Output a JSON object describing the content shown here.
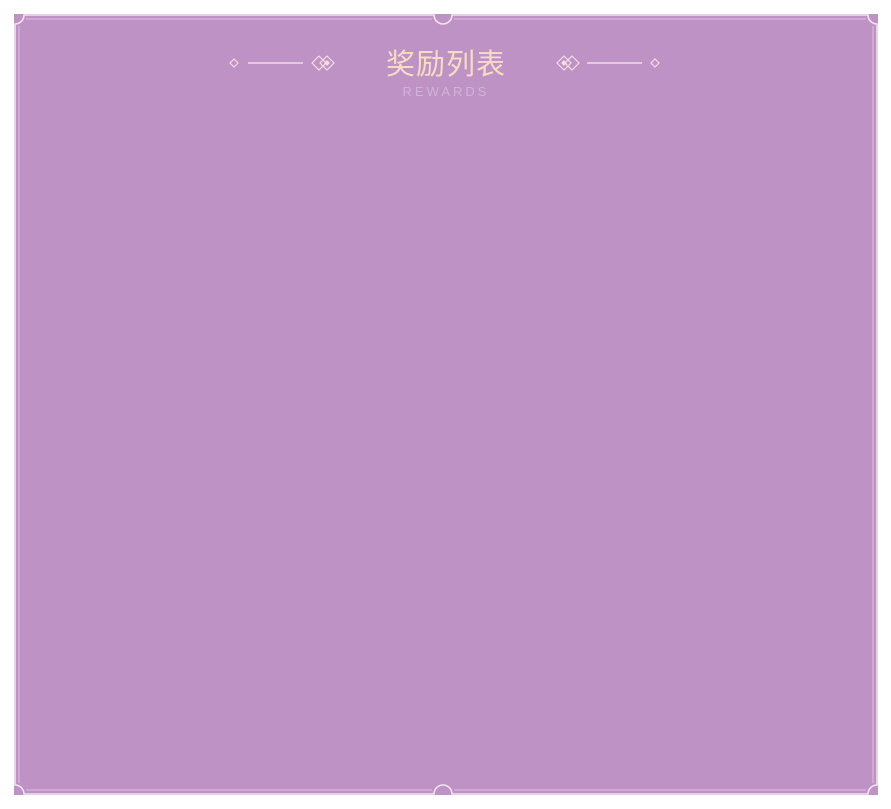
{
  "rewards_panel": {
    "title": "奖励列表",
    "subtitle": "REWARDS",
    "items": []
  },
  "colors": {
    "panel_background": "#be92c4",
    "frame_line": "#f3e3ef",
    "title_text": "#f6dcc4",
    "subtitle_text": "#d2b3d8"
  },
  "icons": {
    "left_ornament": "diamond-line-ornament-icon",
    "right_ornament": "diamond-line-ornament-icon"
  }
}
